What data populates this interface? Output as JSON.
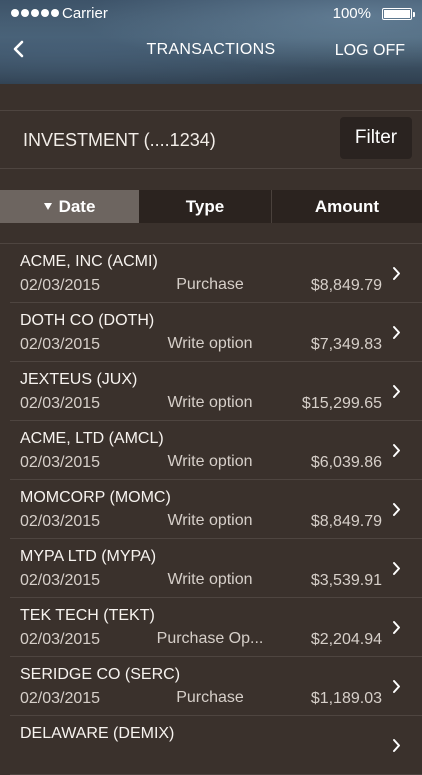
{
  "status_bar": {
    "carrier": "Carrier",
    "battery_percent": "100%"
  },
  "nav": {
    "back_icon": "chevron-left-icon",
    "title": "TRANSACTIONS",
    "logoff_label": "LOG OFF"
  },
  "account": {
    "label": "INVESTMENT (....1234)",
    "filter_label": "Filter"
  },
  "sort_tabs": [
    {
      "label": "Date",
      "active": true,
      "sort_icon": "caret-down-icon"
    },
    {
      "label": "Type",
      "active": false
    },
    {
      "label": "Amount",
      "active": false
    }
  ],
  "transactions": [
    {
      "name": "ACME, INC (ACMI)",
      "date": "02/03/2015",
      "type": "Purchase",
      "amount": "$8,849.79"
    },
    {
      "name": "DOTH CO (DOTH)",
      "date": "02/03/2015",
      "type": "Write option",
      "amount": "$7,349.83"
    },
    {
      "name": "JEXTEUS (JUX)",
      "date": "02/03/2015",
      "type": "Write option",
      "amount": "$15,299.65"
    },
    {
      "name": "ACME, LTD (AMCL)",
      "date": "02/03/2015",
      "type": "Write option",
      "amount": "$6,039.86"
    },
    {
      "name": "MOMCORP (MOMC)",
      "date": "02/03/2015",
      "type": "Write option",
      "amount": "$8,849.79"
    },
    {
      "name": "MYPA LTD (MYPA)",
      "date": "02/03/2015",
      "type": "Write option",
      "amount": "$3,539.91"
    },
    {
      "name": "TEK TECH (TEKT)",
      "date": "02/03/2015",
      "type": "Purchase Op...",
      "amount": "$2,204.94"
    },
    {
      "name": "SERIDGE CO (SERC)",
      "date": "02/03/2015",
      "type": "Purchase",
      "amount": "$1,189.03"
    },
    {
      "name": "DELAWARE (DEMIX)",
      "date": "",
      "type": "",
      "amount": ""
    }
  ],
  "colors": {
    "background": "#3a312c",
    "tab_active": "#6d6560",
    "tab_bar": "#2b231f",
    "filter_button": "#2a2320"
  }
}
